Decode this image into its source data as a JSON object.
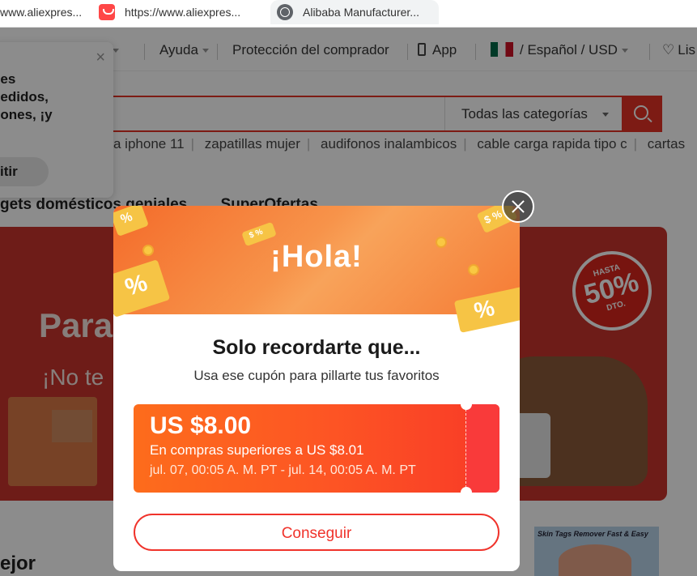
{
  "browser_tabs": [
    {
      "label": "www.aliexpres...",
      "icon": "blank-page-icon"
    },
    {
      "label": "https://www.aliexpres...",
      "icon": "aliexpress-icon"
    },
    {
      "label": "Alibaba Manufacturer...",
      "icon": "globe-icon"
    }
  ],
  "topnav": {
    "help": "Ayuda",
    "buyer_protection": "Protección del comprador",
    "app": "App",
    "lang_currency": "/ Español / USD",
    "wishlist_partial": "Lis",
    "partial_left": "s"
  },
  "search": {
    "category": "Todas las categorías"
  },
  "hot_searches": [
    "a iphone 11",
    "zapatillas mujer",
    "audifonos inalambicos",
    "cable carga rapida tipo c",
    "cartas"
  ],
  "category_row": [
    "gets domésticos geniales",
    "SuperOfertas"
  ],
  "banner": {
    "headline": "Para",
    "subline": "¡No te",
    "badge_top": "HASTA",
    "badge_pct": "50%",
    "badge_bottom": "DTO."
  },
  "bottom": {
    "left_heading": "ejor",
    "ad_text": "Skin Tags Remover Fast & Easy"
  },
  "notification": {
    "line1": "nes",
    "line2": "pedidos,",
    "line3": "pones, ¡y",
    "button": "itir"
  },
  "modal": {
    "header_text": "¡Hola!",
    "title": "Solo recordarte que...",
    "subtitle": "Usa ese cupón para pillarte tus favoritos",
    "coupon": {
      "amount": "US $8.00",
      "condition": "En compras superiores a US $8.01",
      "validity": "jul. 07, 00:05 A. M. PT - jul. 14, 00:05 A. M. PT"
    },
    "button": "Conseguir"
  },
  "colors": {
    "brand_red": "#e43225",
    "coupon_orange": "#fd6c1c",
    "button_red": "#f0332b"
  }
}
